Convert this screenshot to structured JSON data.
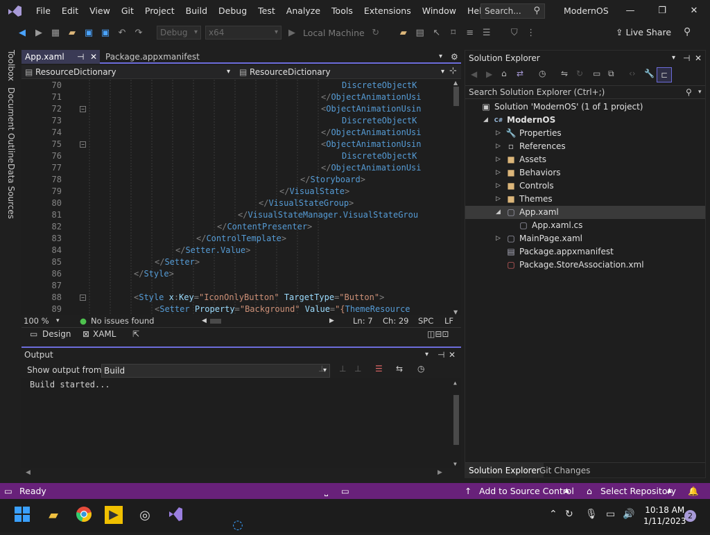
{
  "menubar": {
    "items": [
      "File",
      "Edit",
      "View",
      "Git",
      "Project",
      "Build",
      "Debug",
      "Test",
      "Analyze",
      "Tools",
      "Extensions",
      "Window",
      "Help"
    ],
    "search_label": "Search...",
    "app_title": "ModernOS"
  },
  "toolbar": {
    "config": "Debug",
    "platform": "x64",
    "run_target": "Local Machine",
    "live_share": "Live Share"
  },
  "side_tabs": [
    "Toolbox",
    "Document Outline",
    "Data Sources"
  ],
  "doc_tabs": [
    {
      "label": "App.xaml",
      "active": true
    },
    {
      "label": "Package.appxmanifest",
      "active": false
    }
  ],
  "nav": {
    "left": "ResourceDictionary",
    "right": "ResourceDictionary"
  },
  "editor": {
    "lines": [
      {
        "n": "70",
        "fold": false,
        "ind": 396,
        "html": "<span class='tag'>DiscreteObjectK</span>"
      },
      {
        "n": "71",
        "fold": false,
        "ind": 366,
        "html": "<span class='pun'>&lt;/</span><span class='tag'>ObjectAnimationUsi</span>"
      },
      {
        "n": "72",
        "fold": true,
        "ind": 366,
        "html": "<span class='pun'>&lt;</span><span class='tag'>ObjectAnimationUsin</span>"
      },
      {
        "n": "73",
        "fold": false,
        "ind": 396,
        "html": "<span class='tag'>DiscreteObjectK</span>"
      },
      {
        "n": "74",
        "fold": false,
        "ind": 366,
        "html": "<span class='pun'>&lt;/</span><span class='tag'>ObjectAnimationUsi</span>"
      },
      {
        "n": "75",
        "fold": true,
        "ind": 366,
        "html": "<span class='pun'>&lt;</span><span class='tag'>ObjectAnimationUsin</span>"
      },
      {
        "n": "76",
        "fold": false,
        "ind": 396,
        "html": "<span class='tag'>DiscreteObjectK</span>"
      },
      {
        "n": "77",
        "fold": false,
        "ind": 366,
        "html": "<span class='pun'>&lt;/</span><span class='tag'>ObjectAnimationUsi</span>"
      },
      {
        "n": "78",
        "fold": false,
        "ind": 336,
        "html": "<span class='pun'>&lt;/</span><span class='tag'>Storyboard</span><span class='pun'>&gt;</span>"
      },
      {
        "n": "79",
        "fold": false,
        "ind": 306,
        "html": "<span class='pun'>&lt;/</span><span class='tag'>VisualState</span><span class='pun'>&gt;</span>"
      },
      {
        "n": "80",
        "fold": false,
        "ind": 276,
        "html": "<span class='pun'>&lt;/</span><span class='tag'>VisualStateGroup</span><span class='pun'>&gt;</span>"
      },
      {
        "n": "81",
        "fold": false,
        "ind": 246,
        "html": "<span class='pun'>&lt;/</span><span class='tag'>VisualStateManager.VisualStateGrou</span>"
      },
      {
        "n": "82",
        "fold": false,
        "ind": 216,
        "html": "<span class='pun'>&lt;/</span><span class='tag'>ContentPresenter</span><span class='pun'>&gt;</span>"
      },
      {
        "n": "83",
        "fold": false,
        "ind": 186,
        "html": "<span class='pun'>&lt;/</span><span class='tag'>ControlTemplate</span><span class='pun'>&gt;</span>"
      },
      {
        "n": "84",
        "fold": false,
        "ind": 156,
        "html": "<span class='pun'>&lt;/</span><span class='tag'>Setter.Value</span><span class='pun'>&gt;</span>"
      },
      {
        "n": "85",
        "fold": false,
        "ind": 126,
        "html": "<span class='pun'>&lt;/</span><span class='tag'>Setter</span><span class='pun'>&gt;</span>"
      },
      {
        "n": "86",
        "fold": false,
        "ind": 96,
        "html": "<span class='pun'>&lt;/</span><span class='tag'>Style</span><span class='pun'>&gt;</span>"
      },
      {
        "n": "87",
        "fold": false,
        "ind": 96,
        "html": ""
      },
      {
        "n": "88",
        "fold": true,
        "ind": 96,
        "html": "<span class='pun'>&lt;</span><span class='tag'>Style</span> <span class='xkey'>x</span><span class='pun'>:</span><span class='attr'>Key</span><span class='pun'>=</span><span class='str'>\"IconOnlyButton\"</span> <span class='attr'>TargetType</span><span class='pun'>=</span><span class='str'>\"Button\"</span><span class='pun'>&gt;</span>"
      },
      {
        "n": "89",
        "fold": false,
        "ind": 126,
        "html": "<span class='pun'>&lt;</span><span class='tag'>Setter</span> <span class='attr'>Property</span><span class='pun'>=</span><span class='str'>\"Background\"</span> <span class='attr'>Value</span><span class='pun'>=</span><span class='str'>\"{</span><span class='tag'>ThemeResource</span>"
      }
    ]
  },
  "edstatus": {
    "zoom": "100 %",
    "issues": "No issues found",
    "ln": "Ln: 7",
    "ch": "Ch: 29",
    "spc": "SPC",
    "lf": "LF"
  },
  "designbar": {
    "design": "Design",
    "xaml": "XAML"
  },
  "output": {
    "title": "Output",
    "show_from": "Show output from:",
    "source": "Build",
    "text": "Build started..."
  },
  "solution": {
    "title": "Solution Explorer",
    "search": "Search Solution Explorer (Ctrl+;)",
    "nodes": [
      {
        "label": "Solution 'ModernOS' (1 of 1 project)",
        "lvl": 0,
        "tri": "",
        "icon": "▣",
        "color": "#c8c8c8",
        "bold": false,
        "sel": false
      },
      {
        "label": "ModernOS",
        "lvl": 1,
        "tri": "◢",
        "icon": "C#",
        "color": "#9bd",
        "bold": true,
        "sel": false
      },
      {
        "label": "Properties",
        "lvl": 2,
        "tri": "▷",
        "icon": "🔧",
        "color": "#ccc",
        "bold": false,
        "sel": false
      },
      {
        "label": "References",
        "lvl": 2,
        "tri": "▷",
        "icon": "▫",
        "color": "#ccc",
        "bold": false,
        "sel": false
      },
      {
        "label": "Assets",
        "lvl": 2,
        "tri": "▷",
        "icon": "■",
        "color": "#dcb67a",
        "bold": false,
        "sel": false
      },
      {
        "label": "Behaviors",
        "lvl": 2,
        "tri": "▷",
        "icon": "■",
        "color": "#dcb67a",
        "bold": false,
        "sel": false
      },
      {
        "label": "Controls",
        "lvl": 2,
        "tri": "▷",
        "icon": "■",
        "color": "#dcb67a",
        "bold": false,
        "sel": false
      },
      {
        "label": "Themes",
        "lvl": 2,
        "tri": "▷",
        "icon": "■",
        "color": "#dcb67a",
        "bold": false,
        "sel": false
      },
      {
        "label": "App.xaml",
        "lvl": 2,
        "tri": "◢",
        "icon": "▢",
        "color": "#aab",
        "bold": false,
        "sel": true
      },
      {
        "label": "App.xaml.cs",
        "lvl": 3,
        "tri": "",
        "icon": "▢",
        "color": "#aab",
        "bold": false,
        "sel": false
      },
      {
        "label": "MainPage.xaml",
        "lvl": 2,
        "tri": "▷",
        "icon": "▢",
        "color": "#aab",
        "bold": false,
        "sel": false
      },
      {
        "label": "Package.appxmanifest",
        "lvl": 2,
        "tri": "",
        "icon": "▤",
        "color": "#aab",
        "bold": false,
        "sel": false
      },
      {
        "label": "Package.StoreAssociation.xml",
        "lvl": 2,
        "tri": "",
        "icon": "▢",
        "color": "#d66",
        "bold": false,
        "sel": false
      }
    ],
    "tabs": [
      "Solution Explorer",
      "Git Changes"
    ]
  },
  "statusbar": {
    "ready": "Ready",
    "source_control": "Add to Source Control",
    "repo": "Select Repository",
    "notif_count": "2"
  },
  "taskbar": {
    "time": "10:18 AM",
    "date": "1/11/2023"
  }
}
